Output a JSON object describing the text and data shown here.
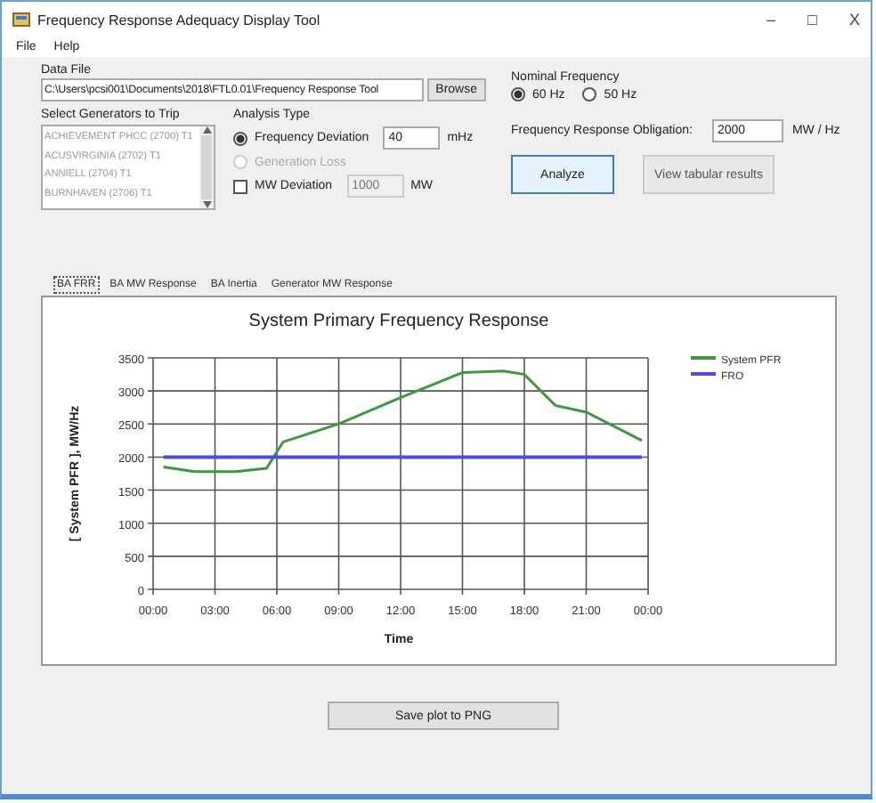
{
  "window": {
    "title": "Frequency Response Adequacy Display Tool",
    "controls": [
      "–",
      "□",
      "X"
    ]
  },
  "menu": [
    "File",
    "Help"
  ],
  "data_file": {
    "label": "Data File",
    "value": "C:\\Users\\pcsi001\\Documents\\2018\\FTL0.01\\Frequency Response Tool",
    "browse": "Browse"
  },
  "generators": {
    "label": "Select Generators to Trip",
    "items": [
      "ACHIEVEMENT PHCC (2700) T1",
      "ACUSVIRGINIA (2702) T1",
      "ANNIELL (2704) T1",
      "BURNHAVEN (2706) T1"
    ]
  },
  "analysis": {
    "label": "Analysis Type",
    "options": [
      {
        "kind": "radio",
        "label": "Frequency Deviation",
        "selected": true,
        "disabled": false,
        "value": "40",
        "unit": "mHz"
      },
      {
        "kind": "radio",
        "label": "Generation Loss",
        "selected": false,
        "disabled": true
      },
      {
        "kind": "checkbox",
        "label": "MW Deviation",
        "checked": false,
        "value": "1000",
        "unit": "MW"
      }
    ]
  },
  "nominal": {
    "label": "Nominal Frequency",
    "options": [
      {
        "label": "60 Hz",
        "selected": true
      },
      {
        "label": "50 Hz",
        "selected": false
      }
    ]
  },
  "obligation": {
    "label": "Frequency Response Obligation:",
    "value": "2000",
    "unit": "MW / Hz"
  },
  "buttons": [
    {
      "label": "Analyze",
      "disabled": false
    },
    {
      "label": "View tabular results",
      "disabled": true
    }
  ],
  "tabs": [
    {
      "label": "BA FRR",
      "selected": true
    },
    {
      "label": "BA MW Response",
      "selected": false
    },
    {
      "label": "BA Inertia",
      "selected": false
    },
    {
      "label": "Generator MW Response",
      "selected": false
    }
  ],
  "chart_data": {
    "type": "line",
    "title": "System Primary Frequency Response",
    "xlabel": "Time",
    "ylabel": "[ System PFR ], MW/Hz",
    "x": [
      0.5,
      2,
      4,
      5.5,
      6.3,
      9,
      12,
      15,
      17,
      18,
      19.5,
      21,
      23.7
    ],
    "series": [
      {
        "name": "System PFR",
        "color": "#3c9a3c",
        "values": [
          1850,
          1780,
          1780,
          1830,
          2230,
          2500,
          2900,
          3280,
          3300,
          3250,
          2780,
          2680,
          2250
        ]
      },
      {
        "name": "FRO",
        "color": "#4b4bf0",
        "values": [
          2000,
          2000,
          2000,
          2000,
          2000,
          2000,
          2000,
          2000,
          2000,
          2000,
          2000,
          2000,
          2000
        ]
      }
    ],
    "xlim": [
      0,
      24
    ],
    "ylim": [
      0,
      3500
    ],
    "grid": true,
    "legend": "right",
    "xticks": [
      {
        "value": 0,
        "label": "00:00"
      },
      {
        "value": 3,
        "label": "03:00"
      },
      {
        "value": 6,
        "label": "06:00"
      },
      {
        "value": 9,
        "label": "09:00"
      },
      {
        "value": 12,
        "label": "12:00"
      },
      {
        "value": 15,
        "label": "15:00"
      },
      {
        "value": 18,
        "label": "18:00"
      },
      {
        "value": 21,
        "label": "21:00"
      },
      {
        "value": 24,
        "label": "00:00"
      }
    ],
    "yticks": [
      0,
      500,
      1000,
      1500,
      2000,
      2500,
      3000,
      3500
    ]
  },
  "save_button": "Save plot to PNG"
}
